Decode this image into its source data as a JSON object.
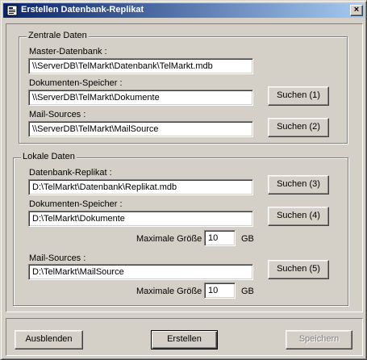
{
  "window": {
    "title": "Erstellen Datenbank-Replikat",
    "close_glyph": "×"
  },
  "central": {
    "title": "Zentrale Daten",
    "master_label": "Master-Datenbank :",
    "master_value": "\\\\ServerDB\\TelMarkt\\Datenbank\\TelMarkt.mdb",
    "docs_label": "Dokumenten-Speicher :",
    "docs_value": "\\\\ServerDB\\TelMarkt\\Dokumente",
    "docs_button": "Suchen (1)",
    "mail_label": "Mail-Sources :",
    "mail_value": "\\\\ServerDB\\TelMarkt\\MailSource",
    "mail_button": "Suchen (2)"
  },
  "local": {
    "title": "Lokale Daten",
    "replica_label": "Datenbank-Replikat :",
    "replica_value": "D:\\TelMarkt\\Datenbank\\Replikat.mdb",
    "replica_button": "Suchen (3)",
    "docs_label": "Dokumenten-Speicher :",
    "docs_value": "D:\\TelMarkt\\Dokumente",
    "docs_button": "Suchen (4)",
    "docs_max_label": "Maximale Größe :",
    "docs_max_value": "10",
    "docs_max_unit": "GB",
    "mail_label": "Mail-Sources :",
    "mail_value": "D:\\TelMarkt\\MailSource",
    "mail_button": "Suchen (5)",
    "mail_max_label": "Maximale Größe :",
    "mail_max_value": "10",
    "mail_max_unit": "GB"
  },
  "footer": {
    "hide_button": "Ausblenden",
    "create_button": "Erstellen",
    "save_button": "Speichern"
  },
  "colors": {
    "titlebar_start": "#0a246a",
    "titlebar_end": "#a6caf0",
    "face": "#d4d0c8"
  },
  "icons": {
    "app": "database-icon",
    "close": "close-icon"
  }
}
